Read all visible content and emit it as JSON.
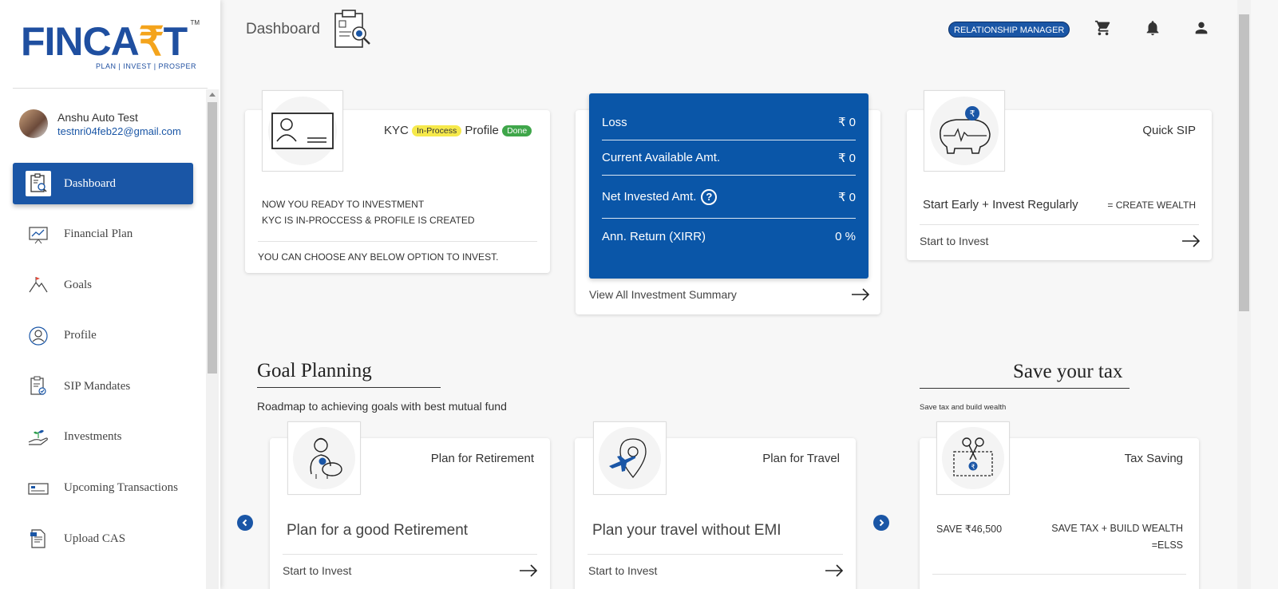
{
  "brand": {
    "name_part1": "FINCA",
    "name_rupee": "₹",
    "name_part2": "T",
    "tm": "TM",
    "tagline": "PLAN | INVEST | PROSPER"
  },
  "user": {
    "name": "Anshu Auto Test",
    "email": "testnri04feb22@gmail.com"
  },
  "sidebar": {
    "items": [
      {
        "label": "Dashboard",
        "icon": "dashboard-clipboard-icon",
        "active": true
      },
      {
        "label": "Financial Plan",
        "icon": "chart-board-icon"
      },
      {
        "label": "Goals",
        "icon": "mountain-flag-icon"
      },
      {
        "label": "Profile",
        "icon": "user-circle-icon"
      },
      {
        "label": "SIP Mandates",
        "icon": "clipboard-check-icon"
      },
      {
        "label": "Investments",
        "icon": "hand-plant-icon"
      },
      {
        "label": "Upcoming Transactions",
        "icon": "card-icon"
      },
      {
        "label": "Upload CAS",
        "icon": "document-upload-icon"
      }
    ]
  },
  "header": {
    "title": "Dashboard",
    "rm_label": "RELATIONSHIP  MANAGER",
    "icons": [
      "cart-icon",
      "bell-icon",
      "account-icon"
    ]
  },
  "kyc_card": {
    "kyc_label": "KYC",
    "kyc_status": "In-Process",
    "profile_label": "Profile",
    "profile_status": "Done",
    "line1": "NOW YOU READY TO INVESTMENT",
    "line2": "KYC IS IN-PROCCESS & PROFILE IS CREATED",
    "footer": "YOU CAN CHOOSE ANY BELOW OPTION TO INVEST."
  },
  "summary": {
    "rows": [
      {
        "label": "Loss",
        "value": "₹ 0"
      },
      {
        "label": "Current Available Amt.",
        "value": "₹ 0"
      },
      {
        "label": "Net Invested Amt.",
        "value": "₹ 0",
        "help": "?"
      },
      {
        "label": "Ann. Return (XIRR)",
        "value": "0 %"
      }
    ],
    "link": "View All Investment Summary"
  },
  "quick_sip": {
    "title": "Quick SIP",
    "tagline": "Start Early + Invest Regularly",
    "result": "= CREATE WEALTH",
    "link": "Start to Invest"
  },
  "goal_planning": {
    "title": "Goal Planning",
    "subtitle": "Roadmap to achieving goals with best mutual fund",
    "cards": [
      {
        "title": "Plan for Retirement",
        "body": "Plan for a good Retirement",
        "link": "Start to Invest"
      },
      {
        "title": "Plan for Travel",
        "body": "Plan your travel without EMI",
        "link": "Start to Invest"
      }
    ]
  },
  "tax": {
    "title": "Save your tax",
    "subtitle": "Save tax and build wealth",
    "card_title": "Tax Saving",
    "save_amount": "SAVE ₹46,500",
    "result_line1": "SAVE TAX + BUILD WEALTH",
    "result_line2": "=ELSS"
  },
  "colors": {
    "primary": "#1a56a6",
    "summary_bg": "#0a56a8",
    "accent_orange": "#f4a41c",
    "badge_yellow": "#f6e94b",
    "badge_green": "#3fa64a"
  }
}
